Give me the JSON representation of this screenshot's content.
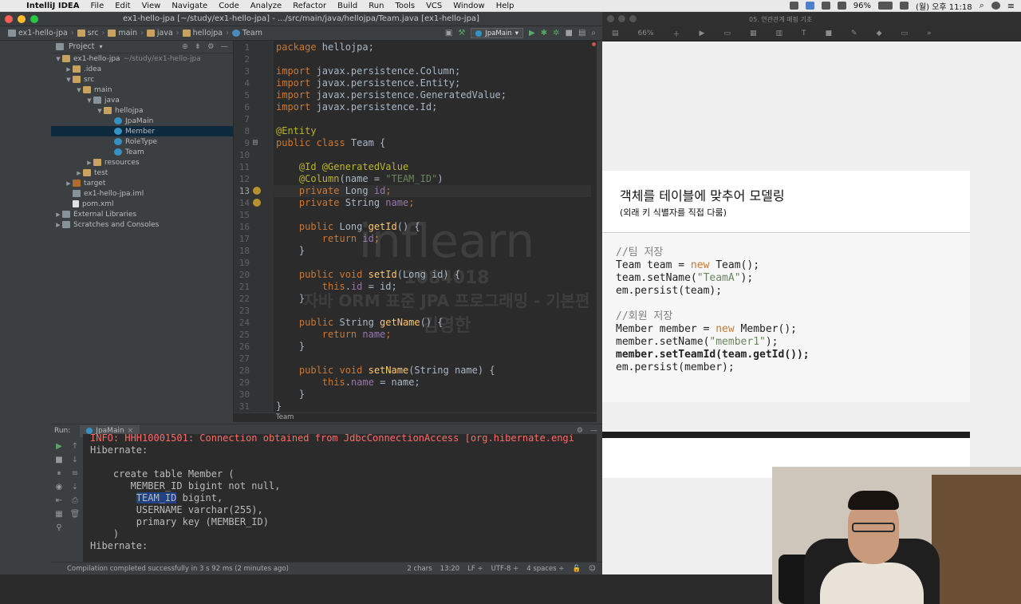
{
  "menubar": {
    "apple": "",
    "items": [
      "IntelliJ IDEA",
      "File",
      "Edit",
      "View",
      "Navigate",
      "Code",
      "Analyze",
      "Refactor",
      "Build",
      "Run",
      "Tools",
      "VCS",
      "Window",
      "Help"
    ],
    "battery": "96%",
    "clock": "(월) 오후 11:18"
  },
  "ide": {
    "window_title": "ex1-hello-jpa [~/study/ex1-hello-jpa] - .../src/main/java/hellojpa/Team.java [ex1-hello-jpa]",
    "breadcrumb": [
      "ex1-hello-jpa",
      "src",
      "main",
      "java",
      "hellojpa",
      "Team"
    ],
    "run_config": "JpaMain",
    "project_panel": {
      "title": "Project",
      "tree": [
        {
          "label": "ex1-hello-jpa",
          "sub": "~/study/ex1-hello-jpa",
          "indent": 0,
          "arrow": "▼",
          "icon": "folder"
        },
        {
          "label": ".idea",
          "indent": 1,
          "arrow": "▶",
          "icon": "folder"
        },
        {
          "label": "src",
          "indent": 1,
          "arrow": "▼",
          "icon": "folder"
        },
        {
          "label": "main",
          "indent": 2,
          "arrow": "▼",
          "icon": "folder"
        },
        {
          "label": "java",
          "indent": 3,
          "arrow": "▼",
          "icon": "folder-src"
        },
        {
          "label": "hellojpa",
          "indent": 4,
          "arrow": "▼",
          "icon": "package"
        },
        {
          "label": "JpaMain",
          "indent": 5,
          "arrow": "",
          "icon": "class"
        },
        {
          "label": "Member",
          "indent": 5,
          "arrow": "",
          "icon": "class",
          "selected": true
        },
        {
          "label": "RoleType",
          "indent": 5,
          "arrow": "",
          "icon": "class"
        },
        {
          "label": "Team",
          "indent": 5,
          "arrow": "",
          "icon": "class"
        },
        {
          "label": "resources",
          "indent": 3,
          "arrow": "▶",
          "icon": "folder"
        },
        {
          "label": "test",
          "indent": 2,
          "arrow": "▶",
          "icon": "folder"
        },
        {
          "label": "target",
          "indent": 1,
          "arrow": "▶",
          "icon": "folder-target"
        },
        {
          "label": "ex1-hello-jpa.iml",
          "indent": 1,
          "arrow": "",
          "icon": "file"
        },
        {
          "label": "pom.xml",
          "indent": 1,
          "arrow": "",
          "icon": "xml"
        },
        {
          "label": "External Libraries",
          "indent": 0,
          "arrow": "▶",
          "icon": "lib"
        },
        {
          "label": "Scratches and Consoles",
          "indent": 0,
          "arrow": "▶",
          "icon": "scratch"
        }
      ]
    },
    "line_numbers": [
      "1",
      "2",
      "3",
      "4",
      "5",
      "6",
      "7",
      "8",
      "9",
      "10",
      "11",
      "12",
      "13",
      "14",
      "15",
      "16",
      "17",
      "18",
      "19",
      "20",
      "21",
      "22",
      "23",
      "24",
      "25",
      "26",
      "27",
      "28",
      "29",
      "30",
      "31"
    ],
    "code": [
      [
        {
          "t": "package",
          "c": "kw"
        },
        {
          "t": " hellojpa;",
          "c": "cls"
        }
      ],
      [],
      [
        {
          "t": "import",
          "c": "kw"
        },
        {
          "t": " javax.persistence.Column;",
          "c": "cls"
        }
      ],
      [
        {
          "t": "import",
          "c": "kw"
        },
        {
          "t": " javax.persistence.Entity;",
          "c": "cls"
        }
      ],
      [
        {
          "t": "import",
          "c": "kw"
        },
        {
          "t": " javax.persistence.GeneratedValue;",
          "c": "cls"
        }
      ],
      [
        {
          "t": "import",
          "c": "kw"
        },
        {
          "t": " javax.persistence.Id;",
          "c": "cls"
        }
      ],
      [],
      [
        {
          "t": "@Entity",
          "c": "an"
        }
      ],
      [
        {
          "t": "public class",
          "c": "kw"
        },
        {
          "t": " Team {",
          "c": "cls"
        }
      ],
      [],
      [
        {
          "t": "    @Id @GeneratedValue",
          "c": "an"
        }
      ],
      [
        {
          "t": "    @Column",
          "c": "an"
        },
        {
          "t": "(name = ",
          "c": "cls"
        },
        {
          "t": "\"TEAM_ID\"",
          "c": "st"
        },
        {
          "t": ")",
          "c": "cls"
        }
      ],
      [
        {
          "t": "    private",
          "c": "kw"
        },
        {
          "t": " Long ",
          "c": "cls"
        },
        {
          "t": "id",
          "c": "fd"
        },
        {
          "t": ";",
          "c": "kw"
        }
      ],
      [
        {
          "t": "    private",
          "c": "kw"
        },
        {
          "t": " String ",
          "c": "cls"
        },
        {
          "t": "name",
          "c": "fd"
        },
        {
          "t": ";",
          "c": "kw"
        }
      ],
      [],
      [
        {
          "t": "    public",
          "c": "kw"
        },
        {
          "t": " Long ",
          "c": "cls"
        },
        {
          "t": "getId",
          "c": "fn"
        },
        {
          "t": "() {",
          "c": "cls"
        }
      ],
      [
        {
          "t": "        return ",
          "c": "kw"
        },
        {
          "t": "id",
          "c": "fd"
        },
        {
          "t": ";",
          "c": "kw"
        }
      ],
      [
        {
          "t": "    }",
          "c": "cls"
        }
      ],
      [],
      [
        {
          "t": "    public void",
          "c": "kw"
        },
        {
          "t": " ",
          "c": "cls"
        },
        {
          "t": "setId",
          "c": "fn"
        },
        {
          "t": "(Long id) {",
          "c": "cls"
        }
      ],
      [
        {
          "t": "        this",
          "c": "kw"
        },
        {
          "t": ".",
          "c": "cls"
        },
        {
          "t": "id",
          "c": "fd"
        },
        {
          "t": " = id;",
          "c": "cls"
        }
      ],
      [
        {
          "t": "    }",
          "c": "cls"
        }
      ],
      [],
      [
        {
          "t": "    public",
          "c": "kw"
        },
        {
          "t": " String ",
          "c": "cls"
        },
        {
          "t": "getName",
          "c": "fn"
        },
        {
          "t": "() {",
          "c": "cls"
        }
      ],
      [
        {
          "t": "        return ",
          "c": "kw"
        },
        {
          "t": "name",
          "c": "fd"
        },
        {
          "t": ";",
          "c": "kw"
        }
      ],
      [
        {
          "t": "    }",
          "c": "cls"
        }
      ],
      [],
      [
        {
          "t": "    public void",
          "c": "kw"
        },
        {
          "t": " ",
          "c": "cls"
        },
        {
          "t": "setName",
          "c": "fn"
        },
        {
          "t": "(String name) {",
          "c": "cls"
        }
      ],
      [
        {
          "t": "        this",
          "c": "kw"
        },
        {
          "t": ".",
          "c": "cls"
        },
        {
          "t": "name",
          "c": "fd"
        },
        {
          "t": " = name;",
          "c": "cls"
        }
      ],
      [
        {
          "t": "    }",
          "c": "cls"
        }
      ],
      [
        {
          "t": "}",
          "c": "cls"
        }
      ]
    ],
    "editor_footer": "Team",
    "run_panel": {
      "label": "Run:",
      "tab": "JpaMain",
      "lines": [
        {
          "t": "INFO: HHH10001501: Connection obtained from JdbcConnectionAccess [org.hibernate.engi",
          "c": "err"
        },
        {
          "t": "Hibernate:",
          "c": ""
        },
        {
          "t": "",
          "c": ""
        },
        {
          "t": "    create table Member (",
          "c": ""
        },
        {
          "t": "       MEMBER_ID bigint not null,",
          "c": ""
        },
        {
          "t": "        TEAM_ID bigint,",
          "c": "hl"
        },
        {
          "t": "        USERNAME varchar(255),",
          "c": ""
        },
        {
          "t": "        primary key (MEMBER_ID)",
          "c": ""
        },
        {
          "t": "    )",
          "c": ""
        },
        {
          "t": "Hibernate:",
          "c": ""
        }
      ]
    },
    "status": {
      "message": "Compilation completed successfully in 3 s 92 ms (2 minutes ago)",
      "chars": "2 chars",
      "position": "13:20",
      "line_sep": "LF ÷",
      "encoding": "UTF-8 ÷",
      "indent": "4 spaces ÷"
    }
  },
  "watermark": {
    "logo": "inflearn",
    "id": "1084018",
    "course": "자바 ORM 표준 JPA 프로그래밍 - 기본편",
    "author": "김영한"
  },
  "keynote": {
    "doc_title": "05. 연관관계 매핑 기초",
    "zoom": "66%",
    "slide": {
      "title": "객체를 테이블에 맞추어 모델링",
      "subtitle": "(외래 키 식별자를 직접 다룸)",
      "code": [
        {
          "parts": [
            {
              "t": "//팀 저장",
              "c": "cm"
            }
          ]
        },
        {
          "parts": [
            {
              "t": "Team team = ",
              "c": ""
            },
            {
              "t": "new",
              "c": "nw"
            },
            {
              "t": " Team();",
              "c": ""
            }
          ]
        },
        {
          "parts": [
            {
              "t": "team.setName(",
              "c": ""
            },
            {
              "t": "\"TeamA\"",
              "c": "ss"
            },
            {
              "t": ");",
              "c": ""
            }
          ]
        },
        {
          "parts": [
            {
              "t": "em.persist(team);",
              "c": ""
            }
          ]
        },
        {
          "parts": []
        },
        {
          "parts": [
            {
              "t": "//회원 저장",
              "c": "cm"
            }
          ]
        },
        {
          "parts": [
            {
              "t": "Member member = ",
              "c": ""
            },
            {
              "t": "new",
              "c": "nw"
            },
            {
              "t": " Member();",
              "c": ""
            }
          ]
        },
        {
          "parts": [
            {
              "t": "member.setName(",
              "c": ""
            },
            {
              "t": "\"member1\"",
              "c": "ss"
            },
            {
              "t": ");",
              "c": ""
            }
          ]
        },
        {
          "parts": [
            {
              "t": "member.setTeamId(team.getId());",
              "c": "bold"
            }
          ]
        },
        {
          "parts": [
            {
              "t": "em.persist(member);",
              "c": ""
            }
          ]
        }
      ]
    }
  }
}
